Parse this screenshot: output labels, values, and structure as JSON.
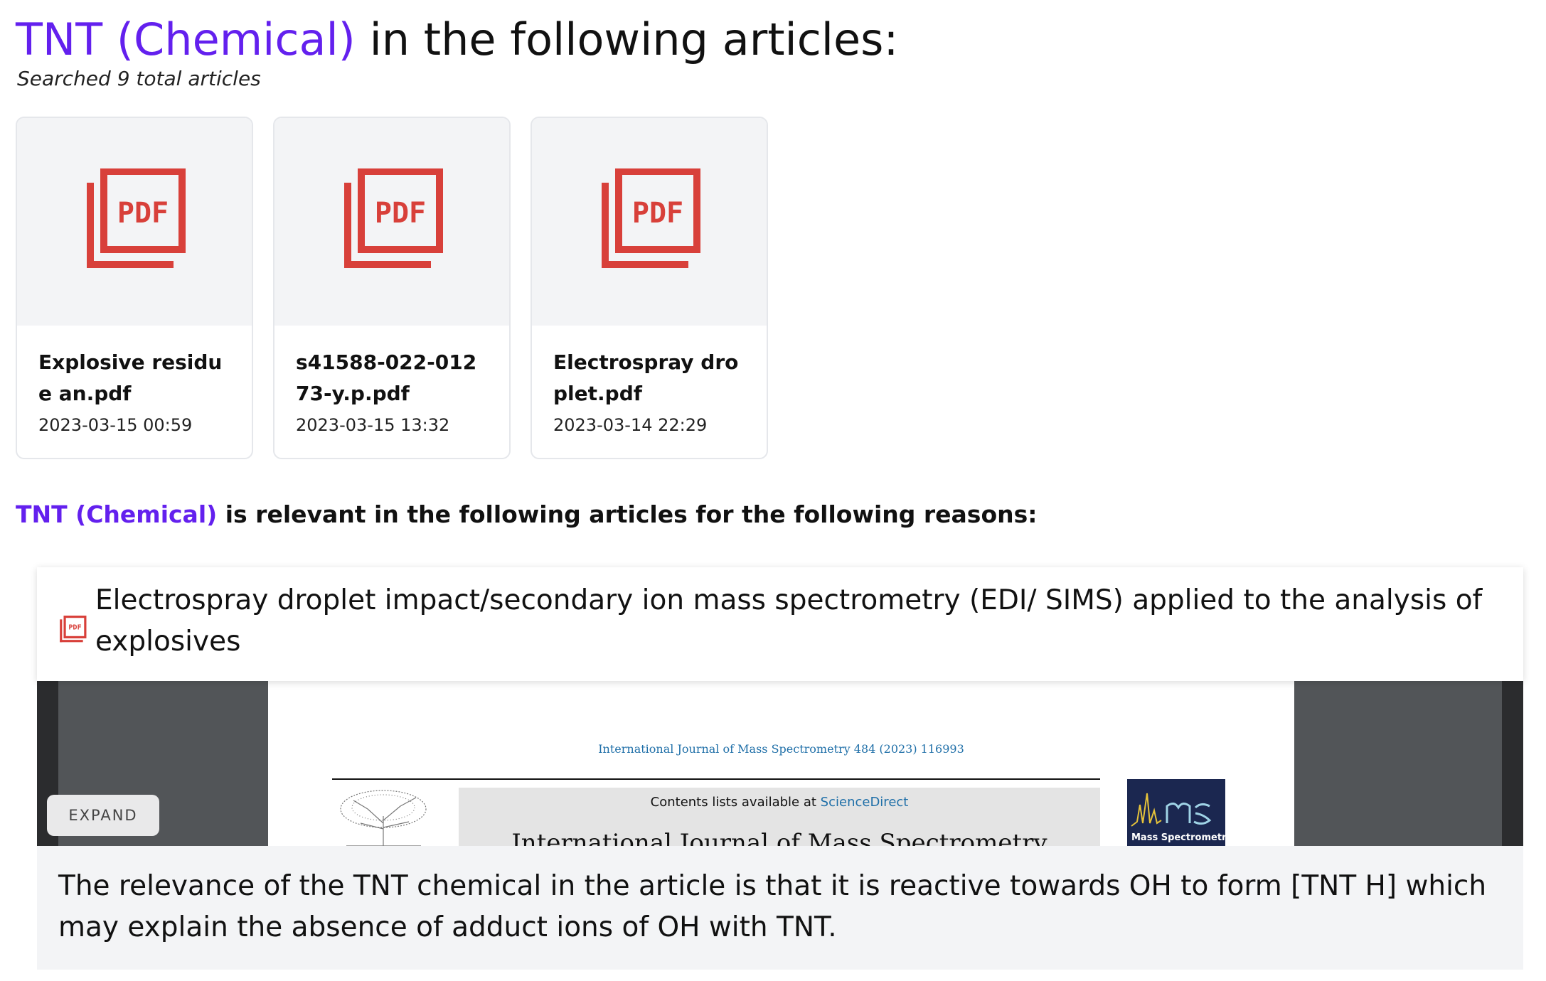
{
  "header": {
    "entity": "TNT (Chemical)",
    "title_suffix": " in the following articles:",
    "subtitle": "Searched 9 total articles"
  },
  "articles": [
    {
      "name": "Explosive residue an.pdf",
      "date": "2023-03-15 00:59",
      "icon": "pdf-icon"
    },
    {
      "name": "s41588-022-01273-y.p.pdf",
      "date": "2023-03-15 13:32",
      "icon": "pdf-icon"
    },
    {
      "name": "Electrospray droplet.pdf",
      "date": "2023-03-14 22:29",
      "icon": "pdf-icon"
    }
  ],
  "reasons": {
    "entity": "TNT (Chemical)",
    "heading_suffix": " is relevant in the following articles for the following reasons:",
    "items": [
      {
        "article_title": "Electrospray droplet impact/secondary ion mass spectrometry (EDI/ SIMS) applied to the analysis of explosives",
        "preview": {
          "journal_cite": "International Journal of Mass Spectrometry 484 (2023) 116993",
          "contents_prefix": "Contents lists available at ",
          "contents_link": "ScienceDirect",
          "journal_name": "International Journal of Mass Spectrometry",
          "cover_title": "Mass Spectrometry"
        },
        "expand_label": "EXPAND",
        "text": "The relevance of the TNT chemical in the article is that it is reactive towards OH  to form [TNT   H] which may explain the absence of adduct ions of OH  with TNT."
      }
    ]
  },
  "colors": {
    "entity": "#6320ee",
    "pdf_icon": "#d8403a",
    "link": "#1f6fa8"
  }
}
